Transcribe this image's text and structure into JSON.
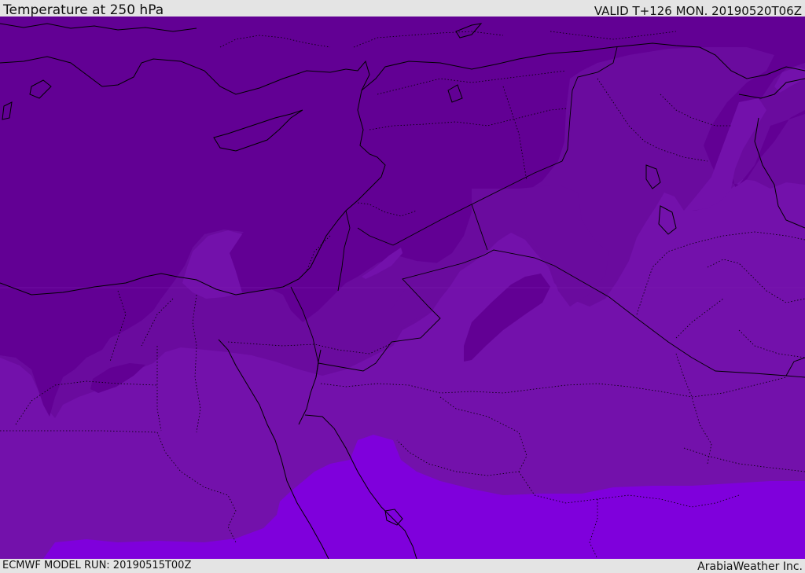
{
  "header": {
    "title": "Temperature at 250 hPa",
    "valid": "VALID T+126 MON. 20190520T06Z"
  },
  "footer": {
    "model_run": "ECMWF MODEL RUN: 20190515T00Z",
    "brand": "ArabiaWeather Inc."
  },
  "map": {
    "field": "Temperature at 250 hPa",
    "palette": {
      "darkest": "#620094",
      "dark": "#6a0b9e",
      "mid": "#7311ab",
      "warm": "#7f00dc"
    },
    "boundary_color": "#000000"
  }
}
